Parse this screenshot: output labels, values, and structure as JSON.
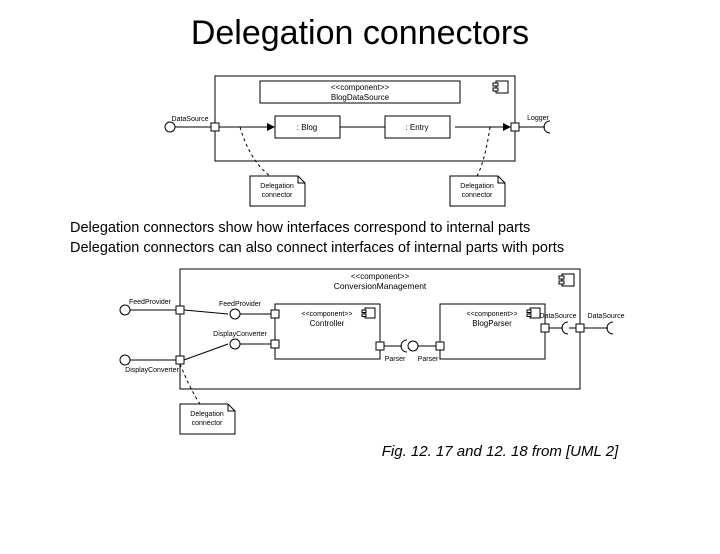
{
  "title": "Delegation connectors",
  "caption_line1": "Delegation connectors show how interfaces correspond to internal parts",
  "caption_line2": "Delegation connectors can also connect interfaces of internal parts with ports",
  "citation": "Fig. 12. 17 and 12. 18  from [UML 2]",
  "diagram1": {
    "stereotype": "<<component>>",
    "component_name": "BlogDataSource",
    "iface_left": "DataSource",
    "part1": ": Blog",
    "part2": ": Entry",
    "iface_right": "Logger",
    "note1": "Delegation connector",
    "note2": "Delegation connector"
  },
  "diagram2": {
    "stereotype": "<<component>>",
    "component_name": "ConversionManagement",
    "ext_iface1": "FeedProvider",
    "ext_iface2": "DisplayConverter",
    "int_iface1": "FeedProvider",
    "int_iface2": "DisplayConverter",
    "controller_stereo": "<<component>>",
    "controller_name": "Controller",
    "controller_req": "Parser",
    "parser_stereo": "<<component>>",
    "parser_name": "BlogParser",
    "parser_prov": "Parser",
    "parser_req": "DataSource",
    "ext_iface_right": "DataSource",
    "note": "Delegation connector"
  }
}
